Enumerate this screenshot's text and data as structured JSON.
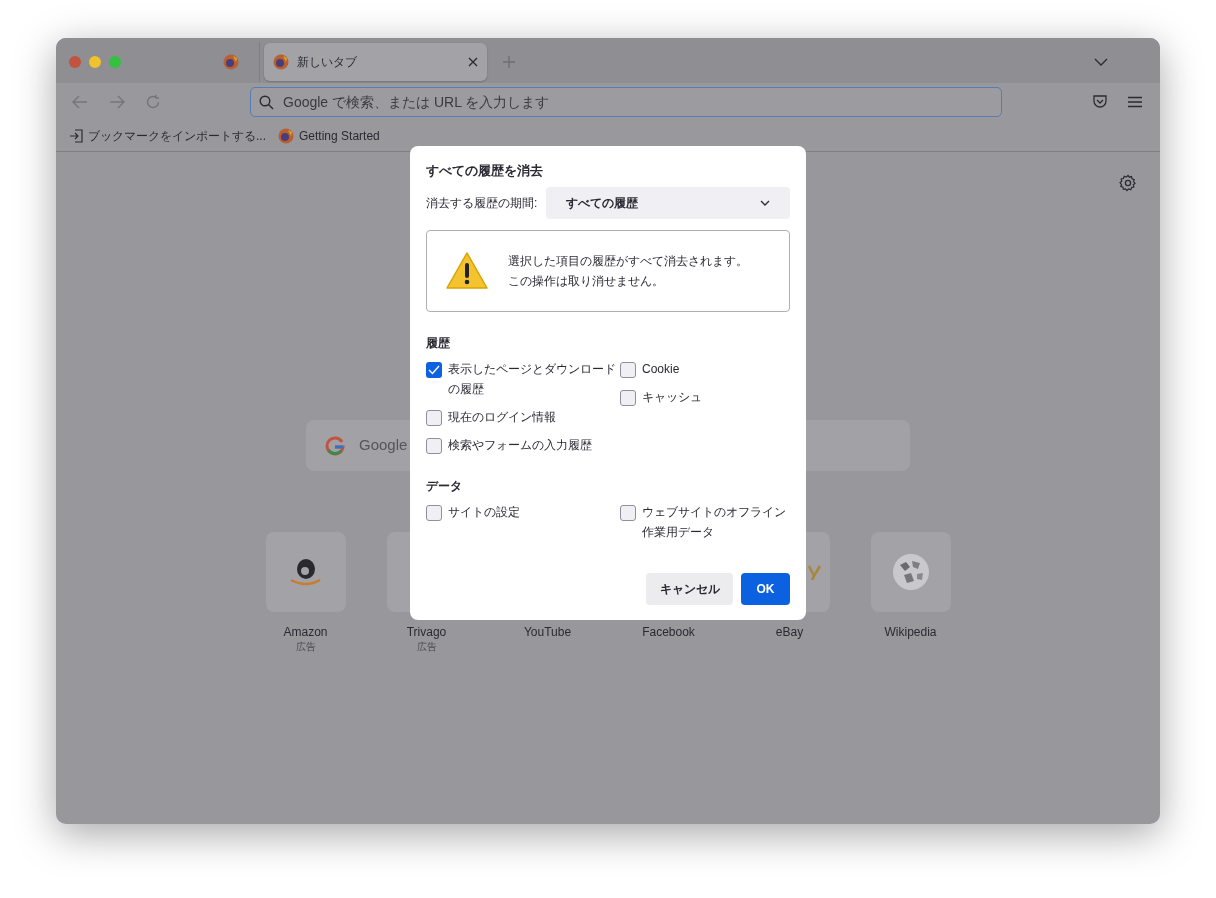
{
  "tabs": [
    {
      "kind": "pinned",
      "selected": false
    },
    {
      "kind": "tab",
      "label": "新しいタブ",
      "selected": true
    }
  ],
  "address_bar": {
    "placeholder": "Google で検索、または URL を入力します"
  },
  "bookmarks": [
    {
      "kind": "import",
      "label": "ブックマークをインポートする..."
    },
    {
      "kind": "firefox",
      "label": "Getting Started"
    }
  ],
  "new_tab": {
    "search": {
      "placeholder": "Google"
    },
    "shortcuts": [
      {
        "kind": "amazon",
        "label": "Amazon",
        "sponsored": "広告"
      },
      {
        "kind": "trivago",
        "label": "Trivago",
        "sponsored": "広告"
      },
      {
        "kind": "covered",
        "label": "YouTube"
      },
      {
        "kind": "covered",
        "label": "Facebook"
      },
      {
        "kind": "ebay",
        "label": "eBay"
      },
      {
        "kind": "wikipedia",
        "label": "Wikipedia"
      }
    ]
  },
  "dialog": {
    "title": "すべての履歴を消去",
    "period_label": "消去する履歴の期間:",
    "period_value": "すべての履歴",
    "warning": [
      "選択した項目の履歴がすべて消去されます。",
      "この操作は取り消せません。"
    ],
    "sections": [
      {
        "heading": "履歴",
        "columns": [
          [
            {
              "label": "表示したページとダウンロードの履歴",
              "checked": true
            },
            {
              "label": "現在のログイン情報",
              "checked": false
            },
            {
              "label": "検索やフォームの入力履歴",
              "checked": false
            }
          ],
          [
            {
              "label": "Cookie",
              "checked": false
            },
            {
              "label": "キャッシュ",
              "checked": false
            }
          ]
        ]
      },
      {
        "heading": "データ",
        "columns": [
          [
            {
              "label": "サイトの設定",
              "checked": false
            }
          ],
          [
            {
              "label": "ウェブサイトのオフライン作業用データ",
              "checked": false
            }
          ]
        ]
      }
    ],
    "buttons": [
      {
        "kind": "secondary",
        "label": "キャンセル"
      },
      {
        "kind": "primary",
        "label": "OK"
      }
    ]
  }
}
